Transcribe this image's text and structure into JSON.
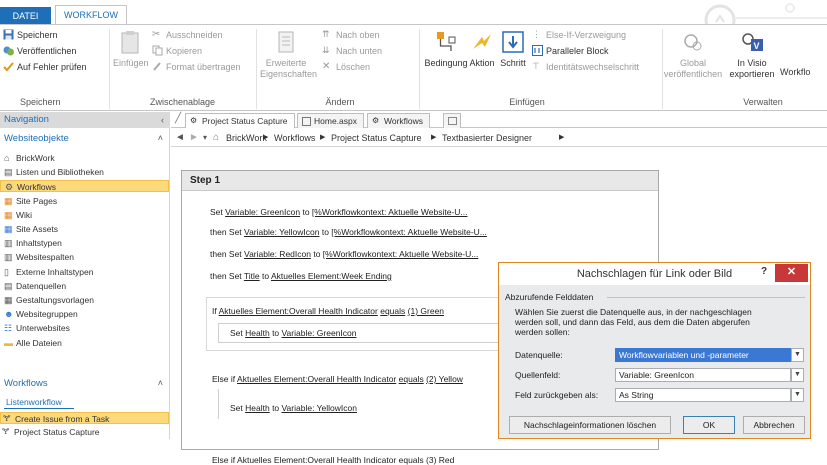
{
  "ribbon_tabs": {
    "datei": "DATEI",
    "workflow": "WORKFLOW"
  },
  "ribbon": {
    "speichern_group": {
      "label": "Speichern",
      "speichern": "Speichern",
      "veroeffentlichen": "Veröffentlichen",
      "auf_fehler_pruefen": "Auf Fehler prüfen"
    },
    "zwischenablage_group": {
      "label": "Zwischenablage",
      "einfuegen": "Einfügen",
      "ausschneiden": "Ausschneiden",
      "kopieren": "Kopieren",
      "format_uebertragen": "Format übertragen"
    },
    "aendern_group": {
      "label": "Ändern",
      "erweiterte_line1": "Erweiterte",
      "erweiterte_line2": "Eigenschaften",
      "nach_oben": "Nach oben",
      "nach_unten": "Nach unten",
      "loeschen": "Löschen"
    },
    "einfuegen_group": {
      "label": "Einfügen",
      "bedingung": "Bedingung",
      "aktion": "Aktion",
      "schritt": "Schritt",
      "else_if": "Else-If-Verzweigung",
      "paralleler_block": "Paralleler Block",
      "identitaetswechsel": "Identitätswechselschritt"
    },
    "verwalten_group": {
      "label": "Verwalten",
      "global_line1": "Global",
      "global_line2": "veröffentlichen",
      "invisio_line1": "In Visio",
      "invisio_line2": "exportieren",
      "workflow_cut": "Workflo"
    }
  },
  "nav": {
    "header": "Navigation",
    "section_websiteobjekte": "Websiteobjekte",
    "items": [
      "BrickWork",
      "Listen und Bibliotheken",
      "Workflows",
      "Site Pages",
      "Wiki",
      "Site Assets",
      "Inhaltstypen",
      "Websitespalten",
      "Externe Inhaltstypen",
      "Datenquellen",
      "Gestaltungsvorlagen",
      "Websitegruppen",
      "Unterwebsites",
      "Alle Dateien"
    ],
    "section_workflows": "Workflows",
    "sub_listenworkflow": "Listenworkflow",
    "workflow_items": [
      "Create Issue from a Task",
      "Project Status Capture"
    ]
  },
  "doc_tabs": [
    "Project Status Capture",
    "Home.aspx",
    "Workflows"
  ],
  "breadcrumb": {
    "items": [
      "BrickWork",
      "Workflows",
      "Project Status Capture",
      "Textbasierter Designer"
    ]
  },
  "step": {
    "title": "Step 1",
    "l1": {
      "a": "Set ",
      "b": "Variable: GreenIcon",
      "c": " to ",
      "d": "[%Workflowkontext: Aktuelle Website-U..."
    },
    "l2": {
      "a": "then Set ",
      "b": "Variable: YellowIcon",
      "c": " to ",
      "d": "[%Workflowkontext: Aktuelle Website-U..."
    },
    "l3": {
      "a": "then Set ",
      "b": "Variable: RedIcon",
      "c": " to ",
      "d": "[%Workflowkontext: Aktuelle Website-U..."
    },
    "l4": {
      "a": "then Set ",
      "b": "Title",
      "c": " to ",
      "d": "Aktuelles Element:Week Ending"
    },
    "if1": {
      "a": "If ",
      "b": "Aktuelles Element:Overall Health Indicator",
      "c": " ",
      "d": "equals",
      "e": " ",
      "f": "(1) Green"
    },
    "set1": {
      "a": "Set ",
      "b": "Health",
      "c": " to ",
      "d": "Variable: GreenIcon"
    },
    "if2": {
      "a": "Else if ",
      "b": "Aktuelles Element:Overall Health Indicator",
      "c": " ",
      "d": "equals",
      "e": " ",
      "f": "(2) Yellow"
    },
    "set2": {
      "a": "Set ",
      "b": "Health",
      "c": " to ",
      "d": "Variable: YellowIcon"
    },
    "if3_cut": "Else if Aktuelles Element:Overall Health Indicator equals (3) Red"
  },
  "dialog": {
    "title": "Nachschlagen für Link oder Bild",
    "help": "?",
    "close": "✕",
    "group_label": "Abzurufende Felddaten",
    "desc1": "Wählen Sie zuerst die Datenquelle aus, in der nachgeschlagen",
    "desc2": "werden soll, und dann das Feld, aus dem die Daten abgerufen",
    "desc3": "werden sollen:",
    "datenquelle_label": "Datenquelle:",
    "datenquelle_value": "Workflowvariablen und -parameter",
    "quellenfeld_label": "Quellenfeld:",
    "quellenfeld_value": "Variable: GreenIcon",
    "feld_label": "Feld zurückgeben als:",
    "feld_value": "As String",
    "btn_loeschen": "Nachschlageinformationen löschen",
    "btn_ok": "OK",
    "btn_abbrechen": "Abbrechen"
  },
  "colors": {
    "accent": "#1e6fb8",
    "selected": "#fcd97a",
    "close": "#c7383a"
  }
}
